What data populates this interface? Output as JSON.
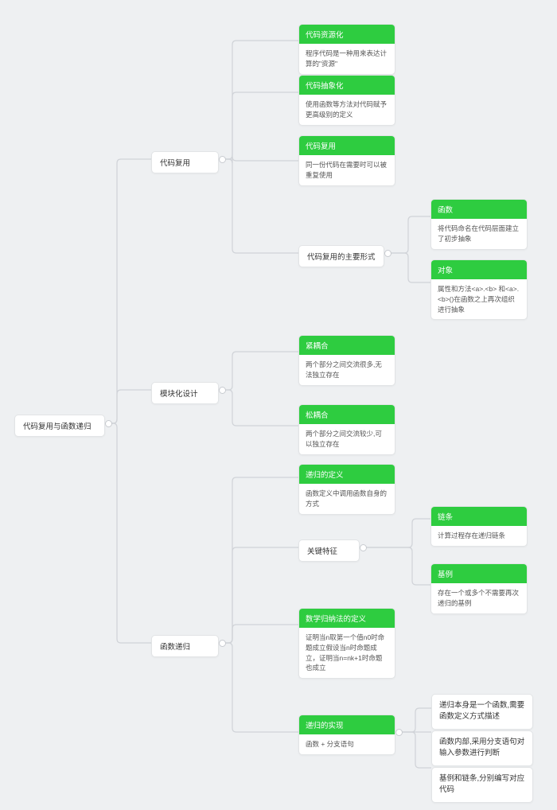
{
  "root": "代码复用与函数递归",
  "b1": "代码复用",
  "b2": "模块化设计",
  "b3": "函数递归",
  "c1": {
    "h": "代码资源化",
    "b": "程序代码是一种用来表达计算的\"资源\""
  },
  "c2": {
    "h": "代码抽象化",
    "b": "使用函数等方法对代码赋予更高级别的定义"
  },
  "c3": {
    "h": "代码复用",
    "b": "同一份代码在需要时可以被重复使用"
  },
  "c4": "代码复用的主要形式",
  "c5": {
    "h": "函数",
    "b": "将代码命名在代码层面建立了初步抽象"
  },
  "c6": {
    "h": "对象",
    "b": "属性和方法<a>.<b> 和<a>.<b>()在函数之上再次组织进行抽象"
  },
  "c7": {
    "h": "紧耦合",
    "b": "两个部分之间交流很多,无法独立存在"
  },
  "c8": {
    "h": "松耦合",
    "b": "两个部分之间交流较少,可以独立存在"
  },
  "c9": {
    "h": "递归的定义",
    "b": "函数定义中调用函数自身的方式"
  },
  "c10": "关键特征",
  "c11": {
    "h": "链条",
    "b": "计算过程存在递归链条"
  },
  "c12": {
    "h": "基例",
    "b": "存在一个或多个不需要再次递归的基例"
  },
  "c13": {
    "h": "数学归纳法的定义",
    "b": "证明当n取第一个值n0时命题成立假设当n时命题成立，证明当n=nk+1时命题也成立"
  },
  "c14": {
    "h": "递归的实现",
    "b": "函数 + 分支语句"
  },
  "l1": "递归本身是一个函数,需要函数定义方式描述",
  "l2": "函数内部,采用分支语句对输入参数进行判断",
  "l3": "基例和链条,分别编写对应代码"
}
